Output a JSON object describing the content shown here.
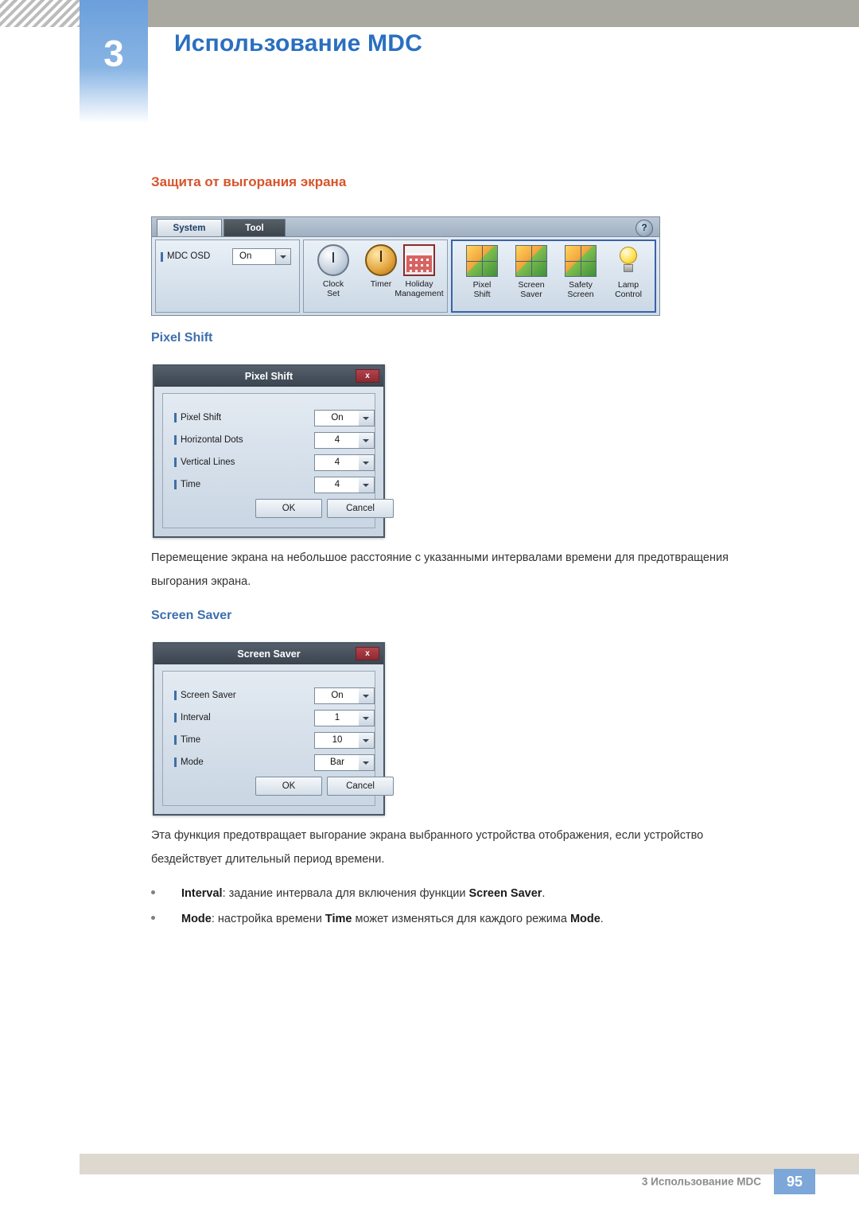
{
  "header": {
    "chapter_number": "3",
    "title": "Использование MDC"
  },
  "section": {
    "title": "Защита от выгорания экрана"
  },
  "mdc_toolbar": {
    "tabs": [
      {
        "label": "System",
        "selected": true
      },
      {
        "label": "Tool",
        "selected": false
      }
    ],
    "help_icon": "?",
    "osd": {
      "label": "MDC OSD",
      "value": "On"
    },
    "tools_left": [
      {
        "line1": "Clock",
        "line2": "Set",
        "icon": "clock-icon"
      },
      {
        "line1": "Timer",
        "line2": "",
        "icon": "timer-icon"
      },
      {
        "line1": "Holiday",
        "line2": "Management",
        "icon": "holiday-icon"
      }
    ],
    "tools_right": [
      {
        "line1": "Pixel",
        "line2": "Shift",
        "icon": "pixel-shift-icon"
      },
      {
        "line1": "Screen",
        "line2": "Saver",
        "icon": "screen-saver-icon"
      },
      {
        "line1": "Safety",
        "line2": "Screen",
        "icon": "safety-screen-icon"
      },
      {
        "line1": "Lamp",
        "line2": "Control",
        "icon": "lamp-control-icon"
      }
    ]
  },
  "pixel_shift": {
    "heading": "Pixel Shift",
    "dialog": {
      "title": "Pixel Shift",
      "close_label": "x",
      "rows": [
        {
          "label": "Pixel Shift",
          "value": "On"
        },
        {
          "label": "Horizontal Dots",
          "value": "4"
        },
        {
          "label": "Vertical Lines",
          "value": "4"
        },
        {
          "label": "Time",
          "value": "4"
        }
      ],
      "ok_label": "OK",
      "cancel_label": "Cancel"
    },
    "paragraph": "Перемещение экрана на небольшое расстояние с указанными интервалами времени для предотвращения выгорания экрана."
  },
  "screen_saver": {
    "heading": "Screen Saver",
    "dialog": {
      "title": "Screen Saver",
      "close_label": "x",
      "rows": [
        {
          "label": "Screen Saver",
          "value": "On"
        },
        {
          "label": "Interval",
          "value": "1"
        },
        {
          "label": "Time",
          "value": "10"
        },
        {
          "label": "Mode",
          "value": "Bar"
        }
      ],
      "ok_label": "OK",
      "cancel_label": "Cancel"
    },
    "paragraph": "Эта функция предотвращает выгорание экрана выбранного устройства отображения, если устройство бездействует длительный период времени.",
    "bullets": [
      {
        "parts": [
          {
            "text": "Interval",
            "bold": true
          },
          {
            "text": ": задание интервала для включения функции ",
            "bold": false
          },
          {
            "text": "Screen Saver",
            "bold": true
          },
          {
            "text": ".",
            "bold": false
          }
        ]
      },
      {
        "parts": [
          {
            "text": "Mode",
            "bold": true
          },
          {
            "text": ": настройка времени ",
            "bold": false
          },
          {
            "text": "Time",
            "bold": true
          },
          {
            "text": " может изменяться для каждого режима ",
            "bold": false
          },
          {
            "text": "Mode",
            "bold": true
          },
          {
            "text": ".",
            "bold": false
          }
        ]
      }
    ]
  },
  "footer": {
    "text": "3 Использование MDC",
    "page": "95"
  }
}
